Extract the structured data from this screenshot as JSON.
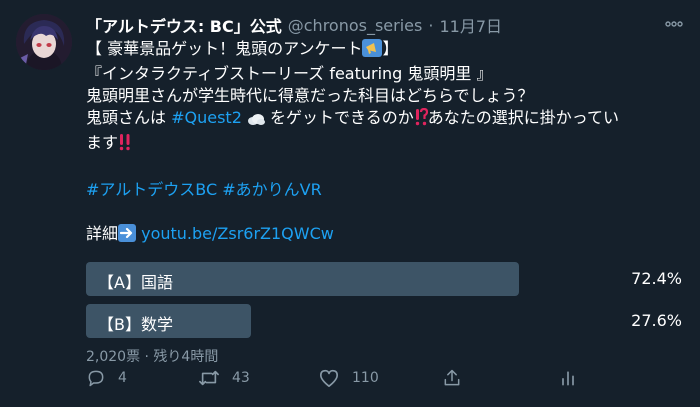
{
  "tweet": {
    "display_name": "「アルトデウス: BC」公式",
    "handle": "@chronos_series",
    "separator": "·",
    "date": "11月7日",
    "lines": {
      "l1_pre": "【 豪華景品ゲット！鬼頭のアンケート",
      "l1_post": "】",
      "l2": "『インタラクティブストーリーズ featuring 鬼頭明里 』",
      "l3": "鬼頭明里さんが学生時代に得意だった科目はどちらでしょう？",
      "l4_pre": "鬼頭さんは ",
      "l4_tag": "#Quest2",
      "l4_post": " をゲットできるのか",
      "l4_end": "あなたの選択に掛かってい",
      "l5": "ます",
      "hashtag1": "#アルトデウスBC",
      "hashtag2": "#あかりんVR",
      "details_label": "詳細",
      "link": "youtu.be/Zsr6rZ1QWCw"
    },
    "icons": {
      "avatar": "avatar-image",
      "more": "more-dots-icon",
      "reply": "reply-icon",
      "retweet": "retweet-icon",
      "like": "heart-icon",
      "share": "share-icon",
      "analytics": "analytics-icon"
    }
  },
  "poll": {
    "options": [
      {
        "label": "【A】国語",
        "percent_text": "72.4%",
        "percent": 72.4
      },
      {
        "label": "【B】数学",
        "percent_text": "27.6%",
        "percent": 27.6
      }
    ],
    "votes_text": "2,020票 · 残り4時間"
  },
  "actions": {
    "replies": "4",
    "retweets": "43",
    "likes": "110"
  },
  "colors": {
    "background": "#15202b",
    "accent": "#1da1f2",
    "muted": "#8899a6",
    "poll_bar": "#3d5466"
  }
}
